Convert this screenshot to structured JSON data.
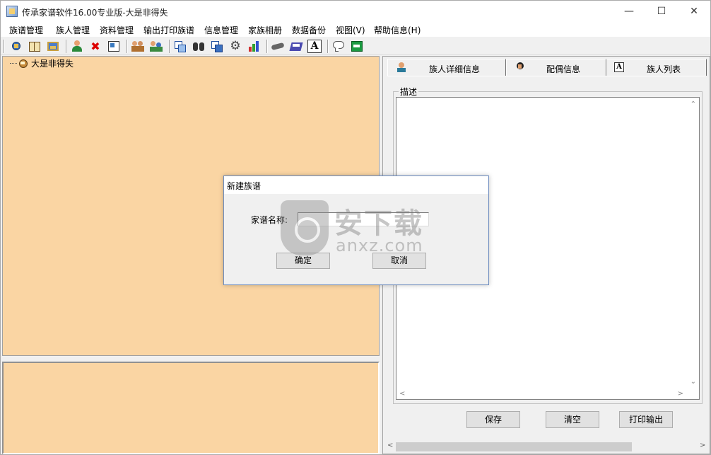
{
  "window": {
    "title": "传承家谱软件16.00专业版-大是非得失"
  },
  "menu": [
    {
      "label": "族谱管理"
    },
    {
      "label": "族人管理"
    },
    {
      "label": "资料管理"
    },
    {
      "label": "输出打印族谱"
    },
    {
      "label": "信息管理"
    },
    {
      "label": "家族相册"
    },
    {
      "label": "数据备份"
    },
    {
      "label": "视图(V)"
    },
    {
      "label": "帮助信息(H)"
    }
  ],
  "toolbar": {
    "icons": [
      "open-book-icon",
      "book-icon",
      "picture-frame-icon",
      "user-add-icon",
      "delete-icon",
      "card-icon",
      "users-icon",
      "users-edit-icon",
      "window-icon",
      "binoculars-icon",
      "copy-icon",
      "gear-icon",
      "bar-chart-icon",
      "handshake-icon",
      "print-book-icon",
      "font-icon",
      "comment-icon",
      "exit-icon"
    ]
  },
  "tree": {
    "root_label": "大是非得失"
  },
  "tabs": [
    {
      "label": "族人详细信息",
      "icon": "person-icon"
    },
    {
      "label": "配偶信息",
      "icon": "spouse-icon"
    },
    {
      "label": "族人列表",
      "icon": "list-icon"
    }
  ],
  "details": {
    "group_title": "描述",
    "save_label": "保存",
    "clear_label": "清空",
    "print_label": "打印输出"
  },
  "dialog": {
    "title": "新建族谱",
    "field_label": "家谱名称:",
    "field_value": "",
    "ok_label": "确定",
    "cancel_label": "取消"
  },
  "watermark": {
    "cn": "安下载",
    "en": "anxz.com"
  }
}
